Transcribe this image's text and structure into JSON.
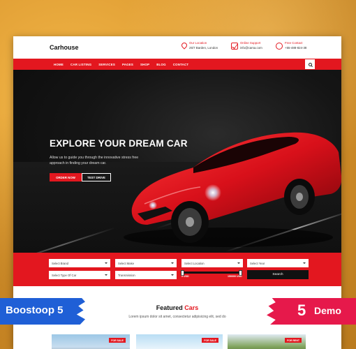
{
  "brand": {
    "name": "Carhouse"
  },
  "contact": {
    "location": {
      "label": "Our Location",
      "value": "25/7 Barden, London"
    },
    "email": {
      "label": "Online Support",
      "value": "info@carsa.com"
    },
    "phone": {
      "label": "Free Contact",
      "value": "+55-488-824-38"
    }
  },
  "nav": {
    "items": [
      "HOME",
      "CAR LISTING",
      "SERVICES",
      "PAGES",
      "SHOP",
      "BLOG",
      "CONTACT"
    ],
    "search_icon": "search-icon"
  },
  "hero": {
    "title": "EXPLORE YOUR DREAM CAR",
    "description": "Allow us to guide you through the innovative stress free approach in finding your dream car.",
    "primary_button": "ORDER NOW",
    "secondary_button": "TEST DRIVE"
  },
  "search": {
    "row1": [
      "Select Brand",
      "Select Make",
      "Select Location",
      "Select Year"
    ],
    "row2": [
      "Select Type Of Car",
      "Transmission"
    ],
    "price_range": {
      "min_label": "5 USD",
      "max_label": "150000 USD",
      "fill_fraction": 1.0
    },
    "button": "Search"
  },
  "featured": {
    "title_prefix": "Featured",
    "title_highlight": "Cars",
    "subtitle": "Lorem ipsum dolor sit amet, consectetur adipisicing elit, sed do",
    "badges": [
      "FOR SALE",
      "FOR SALE",
      "FOR RENT"
    ]
  },
  "overlay": {
    "left_label": "Boostoop 5",
    "right_number": "5",
    "right_label": "Demo"
  },
  "colors": {
    "accent": "#e3171f",
    "ribbon_left": "#1f5fd6",
    "ribbon_right": "#e6194b",
    "background": "#e8a43a"
  }
}
